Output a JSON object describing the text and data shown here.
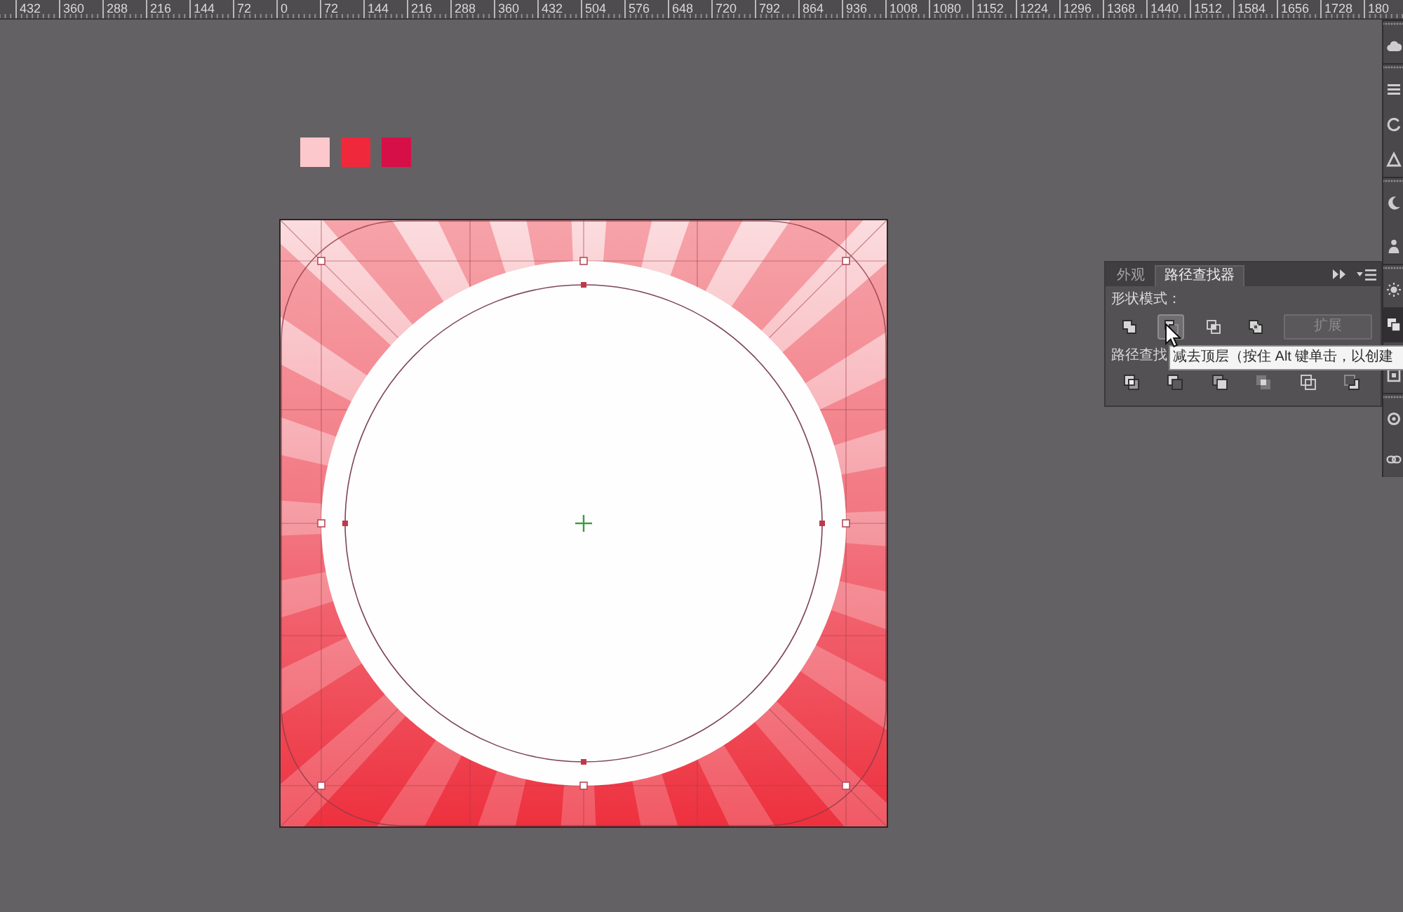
{
  "ruler": {
    "labels": [
      "432",
      "360",
      "288",
      "216",
      "144",
      "72",
      "0",
      "72",
      "144",
      "216",
      "288",
      "360",
      "432",
      "504",
      "576",
      "648",
      "720",
      "792",
      "864",
      "936",
      "1008",
      "1080",
      "1152",
      "1224",
      "1296",
      "1368",
      "1440",
      "1512",
      "1584",
      "1656",
      "1728",
      "180"
    ]
  },
  "swatches": [
    {
      "color": "#fdc8cc"
    },
    {
      "color": "#f0283c"
    },
    {
      "color": "#d70f48"
    }
  ],
  "artboard": {
    "circle_selected": true
  },
  "panel": {
    "tabs": [
      {
        "label": "外观",
        "selected": false
      },
      {
        "label": "路径查找器",
        "selected": true
      }
    ],
    "shape_modes": {
      "label": "形状模式：",
      "buttons": [
        {
          "highlighted": false
        },
        {
          "highlighted": true
        },
        {
          "highlighted": false
        },
        {
          "highlighted": false
        }
      ],
      "expand_button": {
        "label": "扩展",
        "disabled": true
      }
    },
    "pathfinders": {
      "label": "路径查找"
    }
  },
  "tooltip": {
    "text": "减去顶层（按住 Alt 键单击，以创建"
  },
  "dock": [
    {
      "items": [
        {
          "selected": false
        }
      ]
    },
    {
      "items": [
        {
          "selected": false
        },
        {
          "selected": false
        },
        {
          "selected": false
        }
      ]
    },
    {
      "items": [
        {
          "selected": false
        },
        {
          "selected": false
        }
      ]
    },
    {
      "items": [
        {
          "selected": false
        },
        {
          "selected": true
        },
        {
          "selected": false
        }
      ]
    },
    {
      "items": [
        {
          "selected": false
        },
        {
          "selected": false
        }
      ]
    }
  ]
}
